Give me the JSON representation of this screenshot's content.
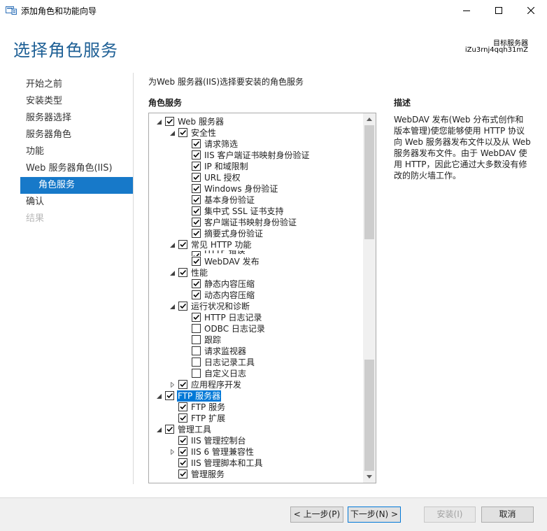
{
  "window": {
    "title": "添加角色和功能向导"
  },
  "header": {
    "heading": "选择角色服务",
    "target_server_label": "目标服务器",
    "target_server_name": "iZu3rnj4qqh31mZ"
  },
  "nav": {
    "items": [
      {
        "label": "开始之前",
        "state": "normal"
      },
      {
        "label": "安装类型",
        "state": "normal"
      },
      {
        "label": "服务器选择",
        "state": "normal"
      },
      {
        "label": "服务器角色",
        "state": "normal"
      },
      {
        "label": "功能",
        "state": "normal"
      },
      {
        "label": "Web 服务器角色(IIS)",
        "state": "normal"
      },
      {
        "label": "角色服务",
        "state": "active"
      },
      {
        "label": "确认",
        "state": "normal"
      },
      {
        "label": "结果",
        "state": "disabled"
      }
    ]
  },
  "main": {
    "instruction": "为Web 服务器(IIS)选择要安装的角色服务",
    "role_services_label": "角色服务",
    "description_label": "描述",
    "description_text": "WebDAV 发布(Web 分布式创作和版本管理)使您能够使用 HTTP 协议向 Web 服务器发布文件以及从 Web 服务器发布文件。由于 WebDAV 使用 HTTP，因此它通过大多数没有修改的防火墙工作。"
  },
  "tree": {
    "rows": [
      {
        "label": "Web 服务器",
        "level": 0,
        "expander": "expanded",
        "checked": true
      },
      {
        "label": "安全性",
        "level": 1,
        "expander": "expanded",
        "checked": true
      },
      {
        "label": "请求筛选",
        "level": 2,
        "expander": "none",
        "checked": true
      },
      {
        "label": "IIS 客户端证书映射身份验证",
        "level": 2,
        "expander": "none",
        "checked": true
      },
      {
        "label": "IP 和域限制",
        "level": 2,
        "expander": "none",
        "checked": true
      },
      {
        "label": "URL 授权",
        "level": 2,
        "expander": "none",
        "checked": true
      },
      {
        "label": "Windows 身份验证",
        "level": 2,
        "expander": "none",
        "checked": true
      },
      {
        "label": "基本身份验证",
        "level": 2,
        "expander": "none",
        "checked": true
      },
      {
        "label": "集中式 SSL 证书支持",
        "level": 2,
        "expander": "none",
        "checked": true
      },
      {
        "label": "客户端证书映射身份验证",
        "level": 2,
        "expander": "none",
        "checked": true
      },
      {
        "label": "摘要式身份验证",
        "level": 2,
        "expander": "none",
        "checked": true
      },
      {
        "label": "常见 HTTP 功能",
        "level": 1,
        "expander": "expanded",
        "checked": true
      },
      {
        "label": "HTTP 错误",
        "level": 2,
        "expander": "none",
        "checked": true,
        "partial": true
      },
      {
        "label": "WebDAV 发布",
        "level": 2,
        "expander": "none",
        "checked": true
      },
      {
        "label": "性能",
        "level": 1,
        "expander": "expanded",
        "checked": true
      },
      {
        "label": "静态内容压缩",
        "level": 2,
        "expander": "none",
        "checked": true
      },
      {
        "label": "动态内容压缩",
        "level": 2,
        "expander": "none",
        "checked": true
      },
      {
        "label": "运行状况和诊断",
        "level": 1,
        "expander": "expanded",
        "checked": true
      },
      {
        "label": "HTTP 日志记录",
        "level": 2,
        "expander": "none",
        "checked": true
      },
      {
        "label": "ODBC 日志记录",
        "level": 2,
        "expander": "none",
        "checked": false
      },
      {
        "label": "跟踪",
        "level": 2,
        "expander": "none",
        "checked": false
      },
      {
        "label": "请求监视器",
        "level": 2,
        "expander": "none",
        "checked": false
      },
      {
        "label": "日志记录工具",
        "level": 2,
        "expander": "none",
        "checked": false
      },
      {
        "label": "自定义日志",
        "level": 2,
        "expander": "none",
        "checked": false
      },
      {
        "label": "应用程序开发",
        "level": 1,
        "expander": "collapsed",
        "checked": true
      },
      {
        "label": "FTP 服务器",
        "level": 0,
        "expander": "expanded",
        "checked": true,
        "selected": true
      },
      {
        "label": "FTP 服务",
        "level": 1,
        "expander": "none",
        "checked": true
      },
      {
        "label": "FTP 扩展",
        "level": 1,
        "expander": "none",
        "checked": true
      },
      {
        "label": "管理工具",
        "level": 0,
        "expander": "expanded",
        "checked": true
      },
      {
        "label": "IIS 管理控制台",
        "level": 1,
        "expander": "none",
        "checked": true
      },
      {
        "label": "IIS 6 管理兼容性",
        "level": 1,
        "expander": "collapsed",
        "checked": true
      },
      {
        "label": "IIS 管理脚本和工具",
        "level": 1,
        "expander": "none",
        "checked": true
      },
      {
        "label": "管理服务",
        "level": 1,
        "expander": "none",
        "checked": true
      }
    ]
  },
  "footer": {
    "prev_label": "< 上一步(P)",
    "next_label": "下一步(N) >",
    "install_label": "安装(I)",
    "cancel_label": "取消"
  }
}
